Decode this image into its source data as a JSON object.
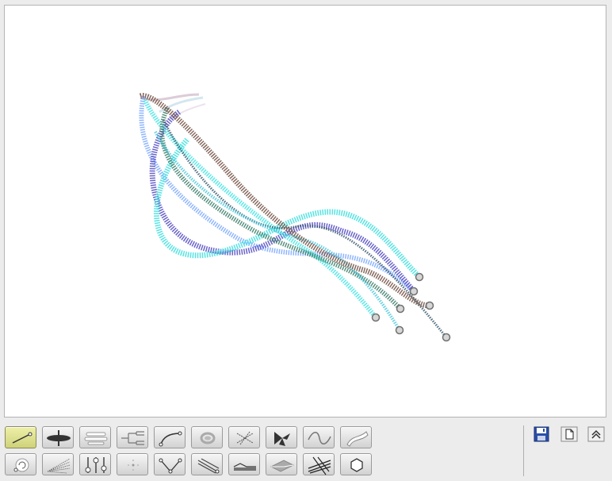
{
  "canvas": {
    "background": "#ffffff",
    "curves": [
      {
        "color": "#7a5a4e",
        "style": "dotted-heavy"
      },
      {
        "color": "#4e9eff",
        "style": "dotted"
      },
      {
        "color": "#5a52c4",
        "style": "dotted"
      },
      {
        "color": "#47e0e0",
        "style": "dotted"
      },
      {
        "color": "#3c7d6a",
        "style": "dotted"
      },
      {
        "color": "#2c4e64",
        "style": "dotted"
      }
    ],
    "handle_color": "#9a9a9a"
  },
  "toolbar": {
    "active_color": "#cfd27a",
    "row1": [
      {
        "name": "line-tool",
        "icon": "line-icon",
        "active": true
      },
      {
        "name": "ellipse-tool",
        "icon": "ellipse-icon",
        "active": false
      },
      {
        "name": "bars-tool",
        "icon": "bars-icon",
        "active": false
      },
      {
        "name": "tree-tool",
        "icon": "tree-icon",
        "active": false
      },
      {
        "name": "arc-tool",
        "icon": "arc-icon",
        "active": false
      },
      {
        "name": "ring-tool",
        "icon": "ring-icon",
        "active": false
      },
      {
        "name": "cross-lines-tool",
        "icon": "cross-lines-icon",
        "active": false
      },
      {
        "name": "fan-tool",
        "icon": "fan-icon",
        "active": false
      },
      {
        "name": "wave-tool",
        "icon": "wave-icon",
        "active": false
      },
      {
        "name": "ribbon-tool",
        "icon": "ribbon-icon",
        "active": false
      }
    ],
    "row2": [
      {
        "name": "spiral-tool",
        "icon": "spiral-icon",
        "active": false
      },
      {
        "name": "rays-tool",
        "icon": "rays-icon",
        "active": false
      },
      {
        "name": "sliders-tool",
        "icon": "sliders-icon",
        "active": false
      },
      {
        "name": "points-tool",
        "icon": "points-icon",
        "active": false
      },
      {
        "name": "v-shape-tool",
        "icon": "v-shape-icon",
        "active": false
      },
      {
        "name": "sweep-tool",
        "icon": "sweep-icon",
        "active": false
      },
      {
        "name": "layers-tool",
        "icon": "layers-icon",
        "active": false
      },
      {
        "name": "fold-tool",
        "icon": "fold-icon",
        "active": false
      },
      {
        "name": "hatch-tool",
        "icon": "hatch-icon",
        "active": false
      },
      {
        "name": "hexagon-tool",
        "icon": "hexagon-icon",
        "active": false
      }
    ]
  },
  "side_actions": [
    {
      "name": "save-button",
      "icon": "save-icon"
    },
    {
      "name": "new-page-button",
      "icon": "new-page-icon"
    },
    {
      "name": "collapse-button",
      "icon": "collapse-up-icon"
    }
  ]
}
